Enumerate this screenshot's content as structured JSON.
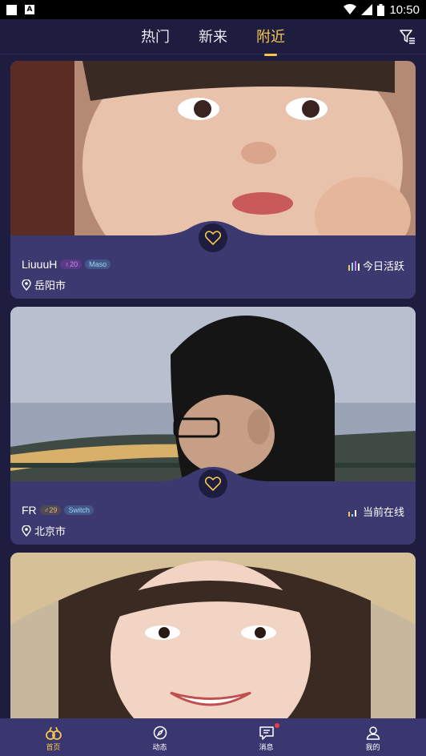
{
  "status_bar": {
    "time": "10:50"
  },
  "tabs": [
    {
      "label": "热门",
      "active": false
    },
    {
      "label": "新来",
      "active": false
    },
    {
      "label": "附近",
      "active": true
    }
  ],
  "cards": [
    {
      "name": "LiuuuH",
      "gender": "female",
      "gender_symbol": "♀",
      "age": "20",
      "role": "Maso",
      "city": "岳阳市",
      "activity": "今日活跃"
    },
    {
      "name": "FR",
      "gender": "male",
      "gender_symbol": "♂",
      "age": "29",
      "role": "Switch",
      "city": "北京市",
      "activity": "当前在线"
    },
    {
      "name": "",
      "role": "",
      "city": "",
      "activity": ""
    }
  ],
  "bottom_nav": [
    {
      "label": "首页",
      "icon": "home-icon",
      "active": true
    },
    {
      "label": "动态",
      "icon": "compass-icon",
      "active": false
    },
    {
      "label": "消息",
      "icon": "message-icon",
      "active": false,
      "has_badge": true
    },
    {
      "label": "我的",
      "icon": "profile-icon",
      "active": false
    }
  ],
  "colors": {
    "background": "#1e1d3f",
    "card": "#3b3970",
    "accent": "#f5c84a",
    "badge": "#e84040"
  }
}
